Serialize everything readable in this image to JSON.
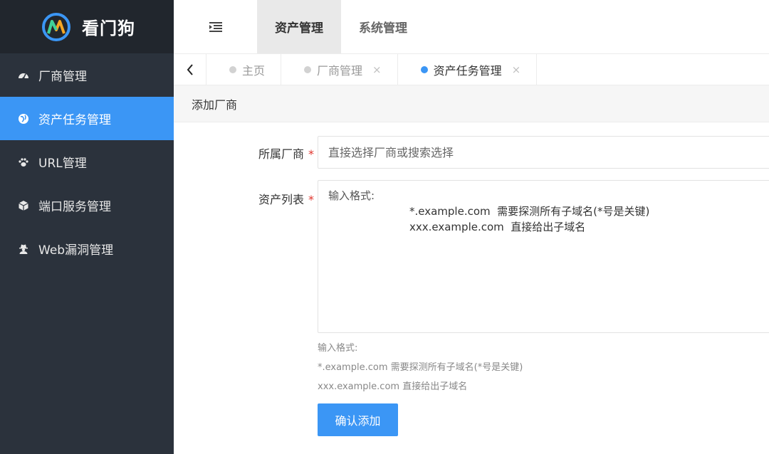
{
  "app": {
    "name": "看门狗",
    "logo_icon": "watchdog-logo-icon"
  },
  "sidebar": {
    "items": [
      {
        "label": "厂商管理",
        "icon": "dashboard-icon",
        "active": false
      },
      {
        "label": "资产任务管理",
        "icon": "globe-icon",
        "active": true
      },
      {
        "label": "URL管理",
        "icon": "paw-icon",
        "active": false
      },
      {
        "label": "端口服务管理",
        "icon": "cube-icon",
        "active": false
      },
      {
        "label": "Web漏洞管理",
        "icon": "user-secret-icon",
        "active": false
      }
    ]
  },
  "header": {
    "fold_icon": "indent-icon",
    "tabs": [
      {
        "label": "资产管理",
        "active": true
      },
      {
        "label": "系统管理",
        "active": false
      }
    ]
  },
  "page_tabs": {
    "back_icon": "chevron-left-icon",
    "tabs": [
      {
        "label": "主页",
        "closable": false,
        "active": false
      },
      {
        "label": "厂商管理",
        "closable": true,
        "active": false
      },
      {
        "label": "资产任务管理",
        "closable": true,
        "active": true
      }
    ],
    "close_glyph": "×"
  },
  "card": {
    "title": "添加厂商"
  },
  "form": {
    "vendor": {
      "label": "所属厂商",
      "required_mark": "*",
      "placeholder": "直接选择厂商或搜索选择",
      "value": ""
    },
    "assets": {
      "label": "资产列表",
      "required_mark": "*",
      "placeholder_lines": [
        "输入格式:",
        "*.example.com  需要探测所有子域名(*号是关键)",
        "xxx.example.com  直接给出子域名"
      ],
      "value": ""
    },
    "help_lines": [
      "输入格式:",
      "*.example.com 需要探测所有子域名(*号是关键)",
      "xxx.example.com 直接给出子域名"
    ],
    "submit_label": "确认添加"
  },
  "colors": {
    "accent": "#3b96f5",
    "sidebar_bg": "#2b323c",
    "brand_bg": "#21262d",
    "required": "#e0342c"
  }
}
